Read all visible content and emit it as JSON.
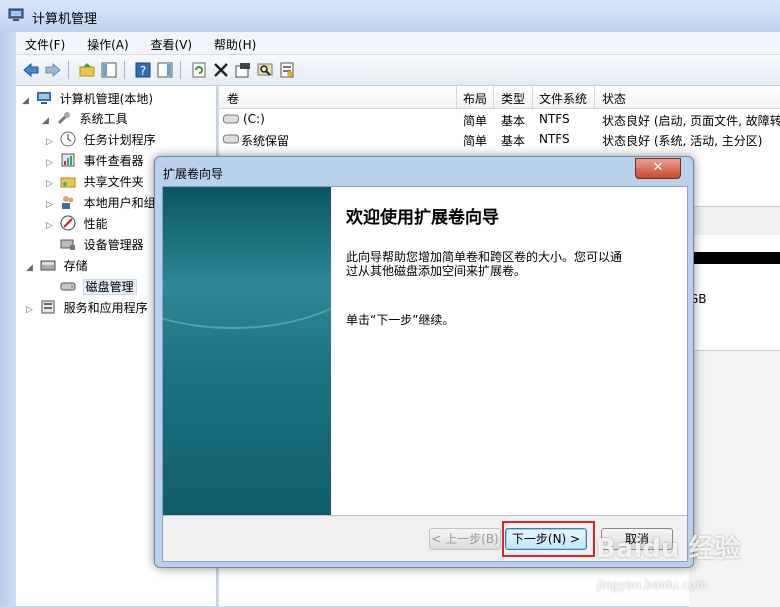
{
  "window": {
    "title": "计算机管理"
  },
  "menu": [
    "文件(F)",
    "操作(A)",
    "查看(V)",
    "帮助(H)"
  ],
  "toolbar_icons": [
    "back-arrow-icon",
    "forward-arrow-icon",
    "up-folder-icon",
    "show-hide-tree-icon",
    "help-icon",
    "action-pane-icon",
    "refresh-icon",
    "delete-icon",
    "properties-icon",
    "search-disk-icon",
    "export-icon"
  ],
  "tree": [
    {
      "label": "计算机管理(本地)",
      "icon": "computer-icon",
      "level": 0,
      "expander": "◢"
    },
    {
      "label": "系统工具",
      "icon": "tools-icon",
      "level": 1,
      "expander": "◢"
    },
    {
      "label": "任务计划程序",
      "icon": "clock-icon",
      "level": 2,
      "expander": "▷"
    },
    {
      "label": "事件查看器",
      "icon": "event-viewer-icon",
      "level": 2,
      "expander": "▷"
    },
    {
      "label": "共享文件夹",
      "icon": "shared-folder-icon",
      "level": 2,
      "expander": "▷"
    },
    {
      "label": "本地用户和组",
      "icon": "users-icon",
      "level": 2,
      "expander": "▷"
    },
    {
      "label": "性能",
      "icon": "performance-icon",
      "level": 2,
      "expander": "▷"
    },
    {
      "label": "设备管理器",
      "icon": "device-manager-icon",
      "level": 2,
      "expander": ""
    },
    {
      "label": "存储",
      "icon": "storage-icon",
      "level": 1,
      "expander": "◢"
    },
    {
      "label": "磁盘管理",
      "icon": "disk-icon",
      "level": 2,
      "expander": "",
      "selected": true
    },
    {
      "label": "服务和应用程序",
      "icon": "services-icon",
      "level": 1,
      "expander": "▷"
    }
  ],
  "table": {
    "columns": [
      "卷",
      "布局",
      "类型",
      "文件系统",
      "状态"
    ],
    "rows": [
      {
        "volume": "(C:)",
        "layout": "简单",
        "type": "基本",
        "fs": "NTFS",
        "status": "状态良好 (启动, 页面文件, 故障转"
      },
      {
        "volume": "系统保留",
        "layout": "简单",
        "type": "基本",
        "fs": "NTFS",
        "status": "状态良好 (系统, 活动, 主分区)"
      }
    ]
  },
  "disk_pane": {
    "size_fragment": "GB"
  },
  "dialog": {
    "title": "扩展卷向导",
    "close": "✕",
    "heading": "欢迎使用扩展卷向导",
    "description_line1": "此向导帮助您增加简单卷和跨区卷的大小。您可以通",
    "description_line2": "过从其他磁盘添加空间来扩展卷。",
    "hint": "单击“下一步”继续。",
    "buttons": {
      "back": "< 上一步(B)",
      "next": "下一步(N) >",
      "cancel": "取消"
    }
  },
  "watermark": {
    "main": "Baidu 经验",
    "sub": "jingyan.baidu.com"
  },
  "colors": {
    "highlight_box": "#e0212b",
    "banner": "#1f7282"
  }
}
